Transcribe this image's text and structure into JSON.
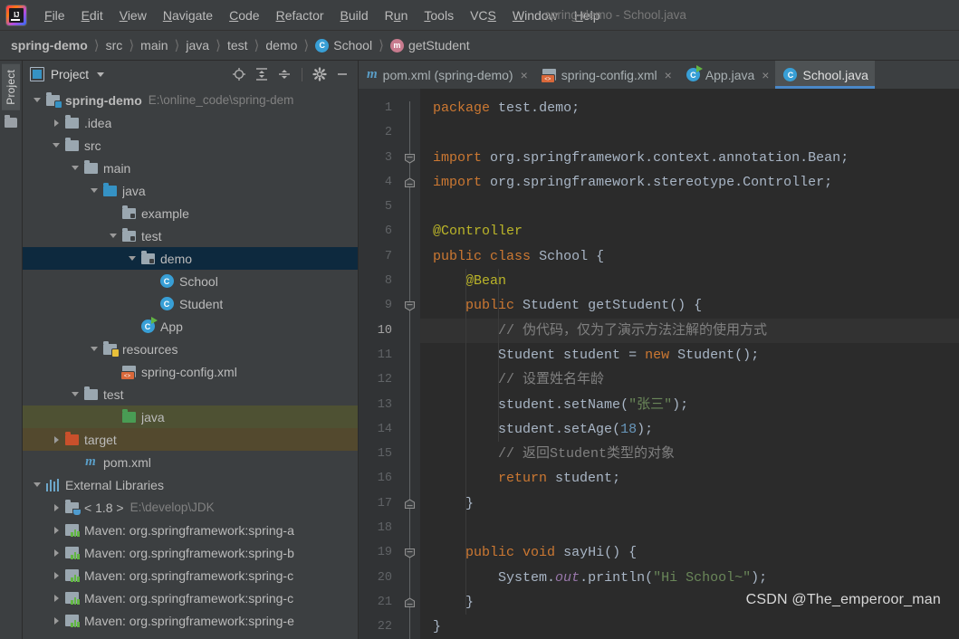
{
  "window": {
    "title": "spring-demo - School.java"
  },
  "menubar": {
    "logo": "ij-logo",
    "items": [
      {
        "label": "File",
        "mnemonic": "F"
      },
      {
        "label": "Edit",
        "mnemonic": "E"
      },
      {
        "label": "View",
        "mnemonic": "V"
      },
      {
        "label": "Navigate",
        "mnemonic": "N"
      },
      {
        "label": "Code",
        "mnemonic": "C"
      },
      {
        "label": "Refactor",
        "mnemonic": "R"
      },
      {
        "label": "Build",
        "mnemonic": "B"
      },
      {
        "label": "Run",
        "mnemonic": "u"
      },
      {
        "label": "Tools",
        "mnemonic": "T"
      },
      {
        "label": "VCS",
        "mnemonic": "S"
      },
      {
        "label": "Window",
        "mnemonic": "W"
      },
      {
        "label": "Help",
        "mnemonic": "H"
      }
    ]
  },
  "navbar": {
    "crumbs": [
      {
        "label": "spring-demo",
        "bold": true,
        "icon": ""
      },
      {
        "label": "src",
        "bold": false,
        "icon": ""
      },
      {
        "label": "main",
        "bold": false,
        "icon": ""
      },
      {
        "label": "java",
        "bold": false,
        "icon": ""
      },
      {
        "label": "test",
        "bold": false,
        "icon": ""
      },
      {
        "label": "demo",
        "bold": false,
        "icon": ""
      },
      {
        "label": "School",
        "bold": false,
        "icon": "class-badge"
      },
      {
        "label": "getStudent",
        "bold": false,
        "icon": "method-badge"
      }
    ],
    "separator": "〉"
  },
  "toolstrip": {
    "project_tab": "Project"
  },
  "project_panel": {
    "title": "Project",
    "tools": [
      {
        "name": "locate-icon",
        "title": "Select Opened File"
      },
      {
        "name": "expand-all-icon",
        "title": "Expand All"
      },
      {
        "name": "collapse-all-icon",
        "title": "Collapse All"
      },
      {
        "name": "gear-icon",
        "title": "Settings"
      },
      {
        "name": "minimize-icon",
        "title": "Hide"
      }
    ],
    "tree": [
      {
        "label": "spring-demo",
        "sub": "E:\\online_code\\spring-dem",
        "indent": 0,
        "arrow": "down",
        "icon": "module-folder",
        "bold": true,
        "state": ""
      },
      {
        "label": ".idea",
        "sub": "",
        "indent": 1,
        "arrow": "right",
        "icon": "folder",
        "bold": false,
        "state": ""
      },
      {
        "label": "src",
        "sub": "",
        "indent": 1,
        "arrow": "down",
        "icon": "folder",
        "bold": false,
        "state": ""
      },
      {
        "label": "main",
        "sub": "",
        "indent": 2,
        "arrow": "down",
        "icon": "folder",
        "bold": false,
        "state": ""
      },
      {
        "label": "java",
        "sub": "",
        "indent": 3,
        "arrow": "down",
        "icon": "source-folder",
        "bold": false,
        "state": ""
      },
      {
        "label": "example",
        "sub": "",
        "indent": 4,
        "arrow": "none",
        "icon": "package",
        "bold": false,
        "state": ""
      },
      {
        "label": "test",
        "sub": "",
        "indent": 4,
        "arrow": "down",
        "icon": "package",
        "bold": false,
        "state": ""
      },
      {
        "label": "demo",
        "sub": "",
        "indent": 5,
        "arrow": "down",
        "icon": "package",
        "bold": false,
        "state": "selected"
      },
      {
        "label": "School",
        "sub": "",
        "indent": 6,
        "arrow": "none",
        "icon": "class",
        "bold": false,
        "state": ""
      },
      {
        "label": "Student",
        "sub": "",
        "indent": 6,
        "arrow": "none",
        "icon": "class",
        "bold": false,
        "state": ""
      },
      {
        "label": "App",
        "sub": "",
        "indent": 5,
        "arrow": "none",
        "icon": "runnable-class",
        "bold": false,
        "state": ""
      },
      {
        "label": "resources",
        "sub": "",
        "indent": 3,
        "arrow": "down",
        "icon": "resource-folder",
        "bold": false,
        "state": ""
      },
      {
        "label": "spring-config.xml",
        "sub": "",
        "indent": 4,
        "arrow": "none",
        "icon": "xml-file",
        "bold": false,
        "state": ""
      },
      {
        "label": "test",
        "sub": "",
        "indent": 2,
        "arrow": "down",
        "icon": "folder",
        "bold": false,
        "state": ""
      },
      {
        "label": "java",
        "sub": "",
        "indent": 4,
        "arrow": "none",
        "icon": "test-source-folder",
        "bold": false,
        "state": "test-root"
      },
      {
        "label": "target",
        "sub": "",
        "indent": 1,
        "arrow": "right",
        "icon": "excluded-folder",
        "bold": false,
        "state": "target"
      },
      {
        "label": "pom.xml",
        "sub": "",
        "indent": 2,
        "arrow": "none",
        "icon": "maven-file",
        "bold": false,
        "state": ""
      },
      {
        "label": "External Libraries",
        "sub": "",
        "indent": 0,
        "arrow": "down",
        "icon": "libraries",
        "bold": false,
        "state": ""
      },
      {
        "label": "< 1.8 >",
        "sub": "E:\\develop\\JDK",
        "indent": 1,
        "arrow": "right",
        "icon": "jdk",
        "bold": false,
        "state": ""
      },
      {
        "label": "Maven: org.springframework:spring-a",
        "sub": "",
        "indent": 1,
        "arrow": "right",
        "icon": "jar",
        "bold": false,
        "state": ""
      },
      {
        "label": "Maven: org.springframework:spring-b",
        "sub": "",
        "indent": 1,
        "arrow": "right",
        "icon": "jar",
        "bold": false,
        "state": ""
      },
      {
        "label": "Maven: org.springframework:spring-c",
        "sub": "",
        "indent": 1,
        "arrow": "right",
        "icon": "jar",
        "bold": false,
        "state": ""
      },
      {
        "label": "Maven: org.springframework:spring-c",
        "sub": "",
        "indent": 1,
        "arrow": "right",
        "icon": "jar",
        "bold": false,
        "state": ""
      },
      {
        "label": "Maven: org.springframework:spring-e",
        "sub": "",
        "indent": 1,
        "arrow": "right",
        "icon": "jar",
        "bold": false,
        "state": ""
      }
    ]
  },
  "editor": {
    "tabs": [
      {
        "label": "pom.xml (spring-demo)",
        "icon": "maven-file",
        "active": false,
        "close": "×"
      },
      {
        "label": "spring-config.xml",
        "icon": "xml-file",
        "active": false,
        "close": "×"
      },
      {
        "label": "App.java",
        "icon": "runnable-class",
        "active": false,
        "close": "×"
      },
      {
        "label": "School.java",
        "icon": "class",
        "active": true,
        "close": ""
      }
    ],
    "current_line": 10,
    "line_numbers": [
      1,
      2,
      3,
      4,
      5,
      6,
      7,
      8,
      9,
      10,
      11,
      12,
      13,
      14,
      15,
      16,
      17,
      18,
      19,
      20,
      21,
      22
    ],
    "fold_markers": [
      {
        "line": 3,
        "type": "collapse-down"
      },
      {
        "line": 4,
        "type": "collapse-up"
      },
      {
        "line": 9,
        "type": "collapse-down"
      },
      {
        "line": 17,
        "type": "collapse-up"
      },
      {
        "line": 19,
        "type": "collapse-down"
      },
      {
        "line": 21,
        "type": "collapse-up"
      }
    ],
    "source_lines": [
      {
        "n": 1,
        "text": "package test.demo;"
      },
      {
        "n": 2,
        "text": ""
      },
      {
        "n": 3,
        "text": "import org.springframework.context.annotation.Bean;"
      },
      {
        "n": 4,
        "text": "import org.springframework.stereotype.Controller;"
      },
      {
        "n": 5,
        "text": ""
      },
      {
        "n": 6,
        "text": "@Controller"
      },
      {
        "n": 7,
        "text": "public class School {"
      },
      {
        "n": 8,
        "text": "    @Bean"
      },
      {
        "n": 9,
        "text": "    public Student getStudent() {"
      },
      {
        "n": 10,
        "text": "        // 伪代码，仅为了演示方法注解的使用方式"
      },
      {
        "n": 11,
        "text": "        Student student = new Student();"
      },
      {
        "n": 12,
        "text": "        // 设置姓名年龄"
      },
      {
        "n": 13,
        "text": "        student.setName(\"张三\");"
      },
      {
        "n": 14,
        "text": "        student.setAge(18);"
      },
      {
        "n": 15,
        "text": "        // 返回Student类型的对象"
      },
      {
        "n": 16,
        "text": "        return student;"
      },
      {
        "n": 17,
        "text": "    }"
      },
      {
        "n": 18,
        "text": ""
      },
      {
        "n": 19,
        "text": "    public void sayHi() {"
      },
      {
        "n": 20,
        "text": "        System.out.println(\"Hi School~\");"
      },
      {
        "n": 21,
        "text": "    }"
      },
      {
        "n": 22,
        "text": "}"
      }
    ],
    "watermark": "CSDN @The_emperoor_man"
  },
  "colors": {
    "bg_panel": "#3c3f41",
    "bg_editor": "#2b2b2b",
    "bg_gutter": "#313335",
    "accent_tab": "#4a88c7",
    "selection": "#0d293e",
    "test_root": "#4e5133",
    "target_row": "#53492e",
    "keyword": "#cc7832",
    "string": "#6a8759",
    "number": "#6897bb",
    "comment": "#808080",
    "annotation": "#bbb529",
    "field": "#9876aa",
    "plain": "#a9b6c6"
  }
}
